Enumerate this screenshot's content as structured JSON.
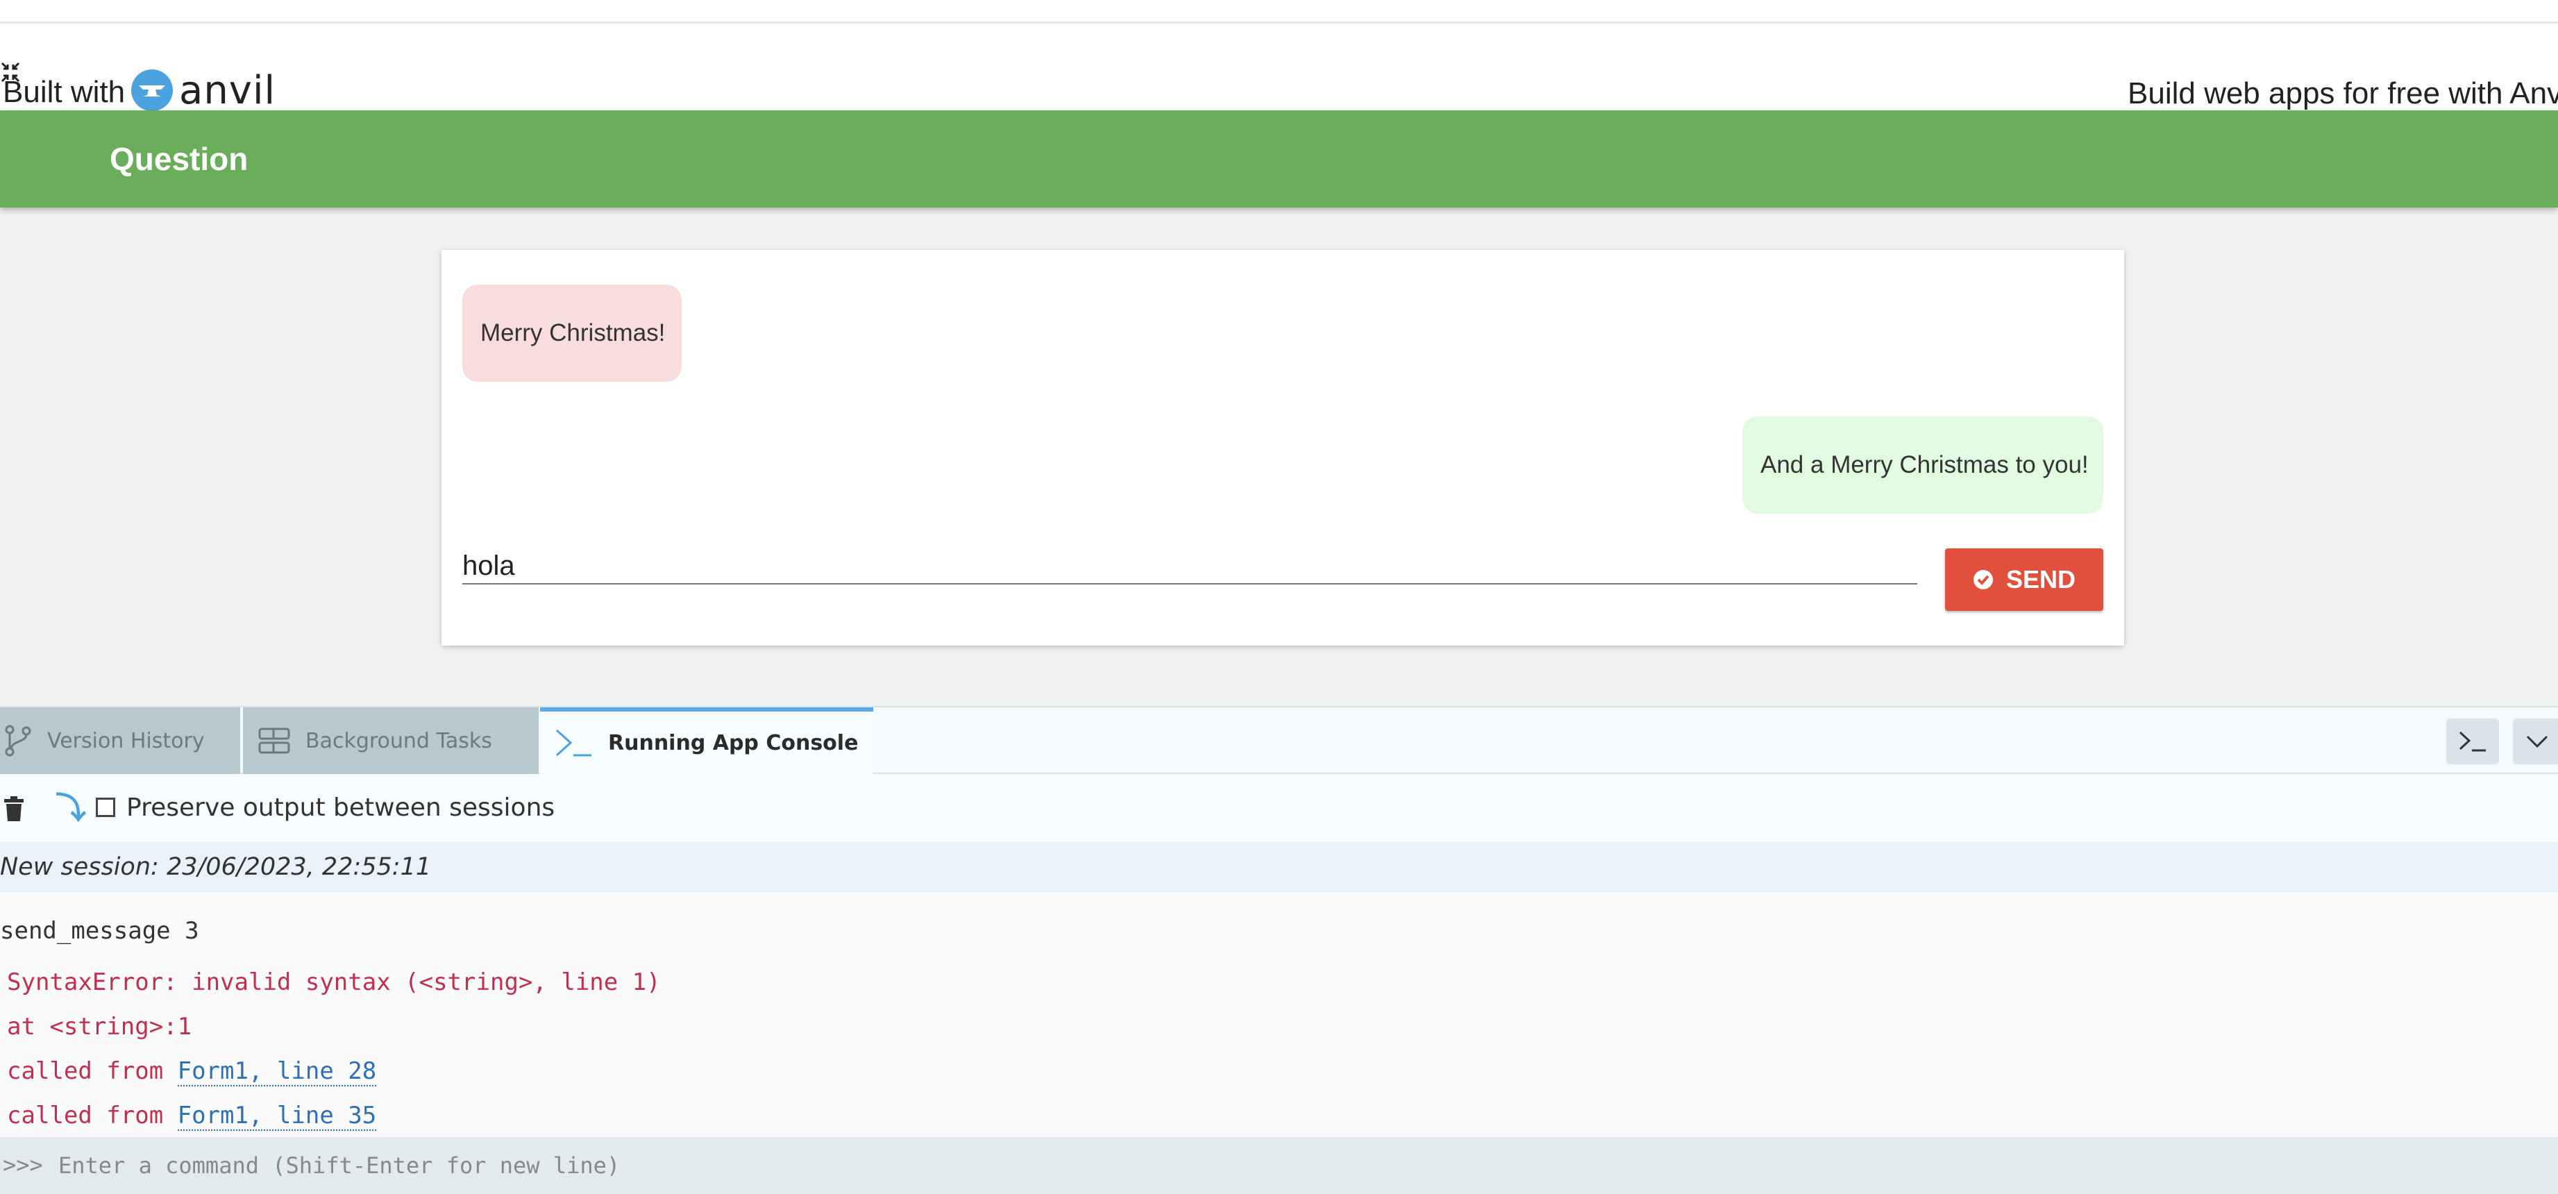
{
  "banner": {
    "built_with": "Built with",
    "brand": "anvil",
    "promo": "Build web apps for free with Anvil"
  },
  "app": {
    "title": "Question",
    "messages": [
      {
        "text": "Merry Christmas!",
        "from": "them"
      },
      {
        "text": "And a Merry Christmas to you!",
        "from": "me"
      }
    ],
    "input_value": "hola",
    "send_label": "SEND"
  },
  "panel": {
    "tabs": [
      {
        "label": "Version History",
        "icon": "branch-icon",
        "active": false
      },
      {
        "label": "Background Tasks",
        "icon": "tasks-icon",
        "active": false
      },
      {
        "label": "Running App Console",
        "icon": "terminal-icon",
        "active": true
      }
    ]
  },
  "console": {
    "preserve_label": "Preserve output between sessions",
    "preserve_checked": false,
    "session": "New session: 23/06/2023, 22:55:11",
    "output_line": "send_message 3",
    "error": "SyntaxError: invalid syntax (<string>, line 1)",
    "at_line": "at <string>:1",
    "called_from_prefix": "called from ",
    "traces": [
      {
        "link": "Form1, line 28"
      },
      {
        "link": "Form1, line 35"
      }
    ],
    "prompt": ">>>",
    "command_placeholder": "Enter a command (Shift-Enter for new line)"
  },
  "colors": {
    "header_green": "#6aae5c",
    "send_red": "#e0503d",
    "bubble_them": "#f9dcdc",
    "bubble_me": "#e2fbe0",
    "error_text": "#c0304e",
    "link_blue": "#2f6fb3",
    "active_tab_accent": "#5aa9e6"
  }
}
